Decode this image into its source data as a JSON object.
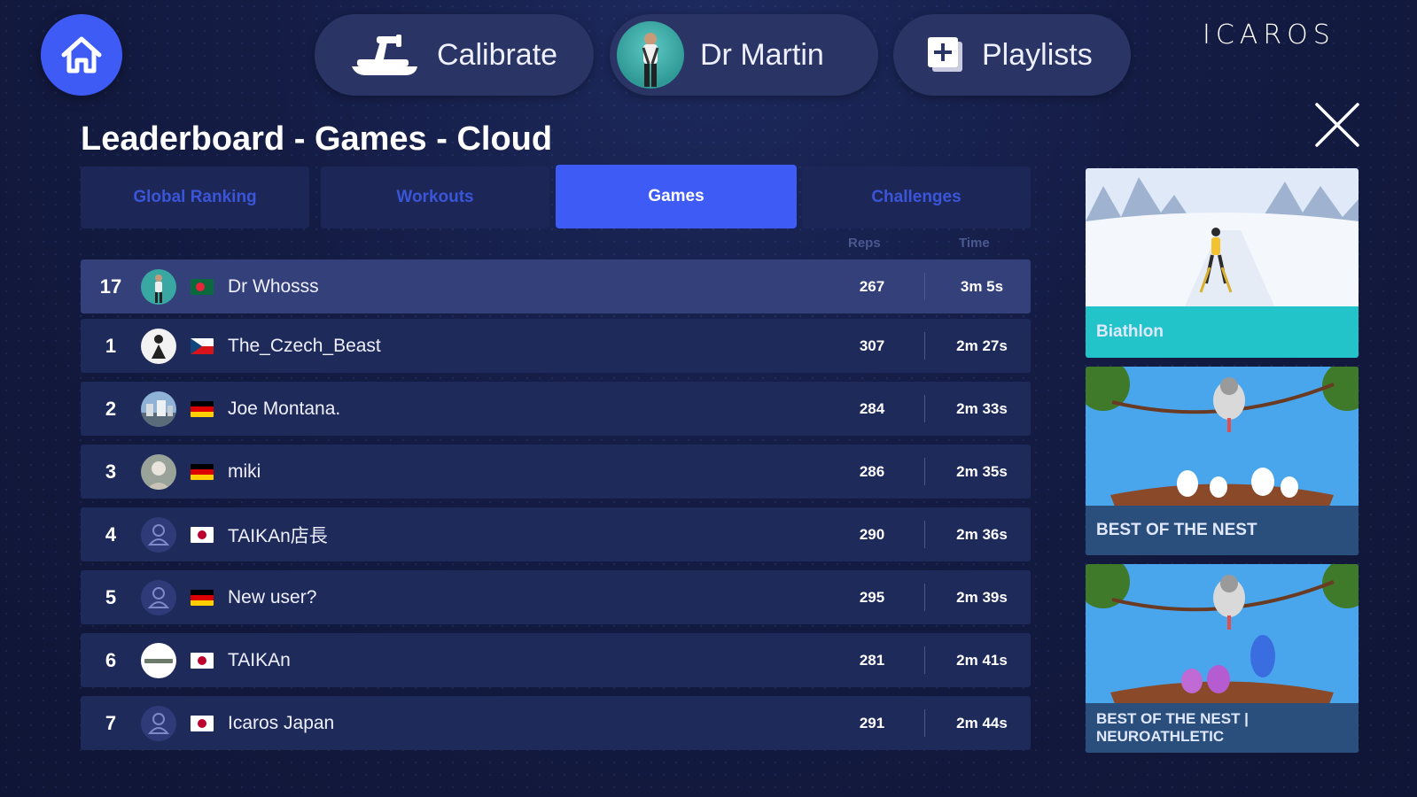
{
  "header": {
    "calibrate_label": "Calibrate",
    "profile_name": "Dr Martin",
    "playlists_label": "Playlists",
    "logo": "ICAROS",
    "icons": {
      "home": "home-icon",
      "calibrate": "calibrate-device-icon",
      "playlists": "add-playlist-icon",
      "close": "close-icon"
    }
  },
  "page": {
    "title": "Leaderboard - Games - Cloud"
  },
  "tabs": [
    {
      "label": "Global Ranking",
      "active": false
    },
    {
      "label": "Workouts",
      "active": false
    },
    {
      "label": "Games",
      "active": true
    },
    {
      "label": "Challenges",
      "active": false
    }
  ],
  "columns": {
    "reps": "Reps",
    "time": "Time"
  },
  "rows": [
    {
      "rank": "17",
      "name": "Dr Whosss",
      "reps": "267",
      "time": "3m 5s",
      "flag": "bangladesh",
      "avatar": "photo-teal",
      "current_user": true
    },
    {
      "rank": "1",
      "name": "The_Czech_Beast",
      "reps": "307",
      "time": "2m 27s",
      "flag": "czech",
      "avatar": "photo-white"
    },
    {
      "rank": "2",
      "name": "Joe Montana.",
      "reps": "284",
      "time": "2m 33s",
      "flag": "germany",
      "avatar": "photo-city"
    },
    {
      "rank": "3",
      "name": "miki",
      "reps": "286",
      "time": "2m 35s",
      "flag": "germany",
      "avatar": "photo-grey"
    },
    {
      "rank": "4",
      "name": "TAIKAn店長",
      "reps": "290",
      "time": "2m 36s",
      "flag": "japan",
      "avatar": "default-user"
    },
    {
      "rank": "5",
      "name": "New user?",
      "reps": "295",
      "time": "2m 39s",
      "flag": "germany",
      "avatar": "default-user"
    },
    {
      "rank": "6",
      "name": "TAIKAn",
      "reps": "281",
      "time": "2m 41s",
      "flag": "japan",
      "avatar": "logo-white"
    },
    {
      "rank": "7",
      "name": "Icaros Japan",
      "reps": "291",
      "time": "2m 44s",
      "flag": "japan",
      "avatar": "default-user"
    }
  ],
  "games": [
    {
      "title": "Biathlon",
      "label_color": "#22c4c9"
    },
    {
      "title": "BEST OF THE NEST",
      "label_color": "#2b4f7d"
    },
    {
      "title": "BEST OF THE NEST | NEUROATHLETIC",
      "label_color": "#2b4f7d"
    }
  ]
}
